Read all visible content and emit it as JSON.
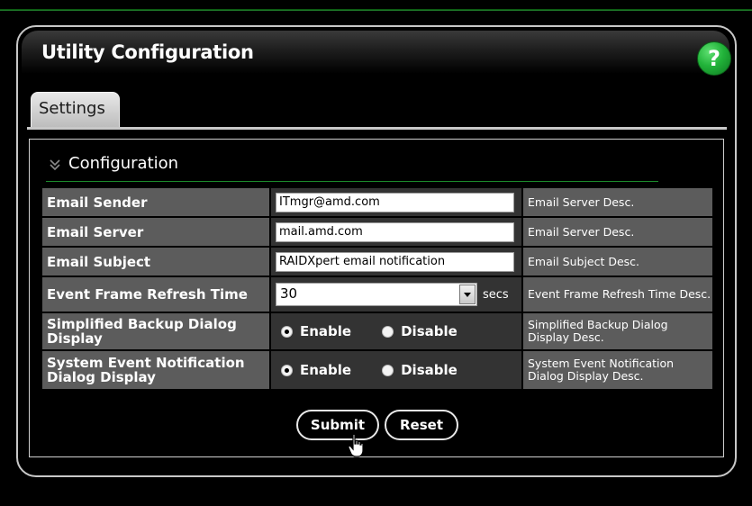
{
  "panel": {
    "title": "Utility Configuration",
    "help_label": "?"
  },
  "tabs": [
    {
      "label": "Settings"
    }
  ],
  "section": {
    "title": "Configuration"
  },
  "rows": [
    {
      "label": "Email Sender",
      "value": "ITmgr@amd.com",
      "desc": "Email Server Desc."
    },
    {
      "label": "Email Server",
      "value": "mail.amd.com",
      "desc": "Email Server Desc."
    },
    {
      "label": "Email Subject",
      "value": "RAIDXpert email notification",
      "desc": "Email Subject Desc."
    },
    {
      "label": "Event Frame Refresh Time",
      "value": "30",
      "unit": "secs",
      "desc": "Event Frame Refresh Time Desc."
    },
    {
      "label": "Simplified Backup Dialog Display",
      "enable": "Enable",
      "disable": "Disable",
      "selected": "Enable",
      "desc": "Simplified Backup Dialog Display Desc."
    },
    {
      "label": "System Event Notification Dialog Display",
      "enable": "Enable",
      "disable": "Disable",
      "selected": "Enable",
      "desc": "System Event Notification Dialog Display Desc."
    }
  ],
  "buttons": {
    "submit": "Submit",
    "reset": "Reset"
  },
  "colors": {
    "accent": "#22b33a",
    "row_label_bg": "#5c5c5c",
    "row_value_bg": "#333333"
  },
  "icons": {
    "help": "help-icon",
    "section": "chevron-double-down-icon",
    "pointer": "hand-pointer-icon"
  }
}
